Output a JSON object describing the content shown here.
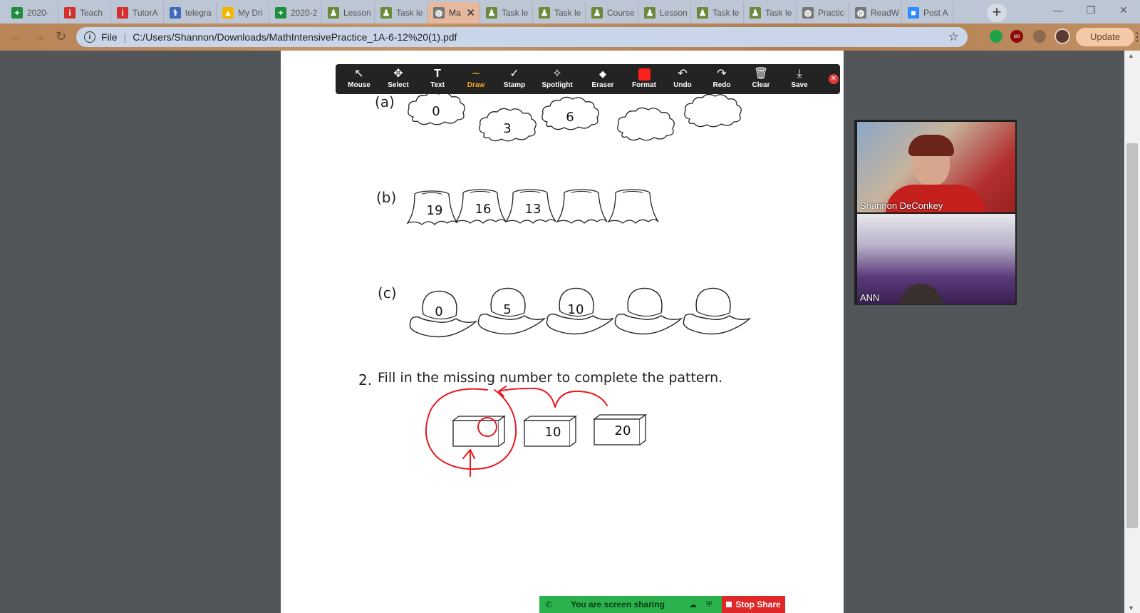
{
  "browser": {
    "tabs": [
      {
        "title": "2020-",
        "icon": "sheets-icon",
        "color": "#1e8e3e"
      },
      {
        "title": "Teach",
        "icon": "instructure-icon",
        "color": "#d32f2f"
      },
      {
        "title": "TutorA",
        "icon": "instructure-icon",
        "color": "#d32f2f"
      },
      {
        "title": "telegra",
        "icon": "telegraph-icon",
        "color": "#3f6ab8"
      },
      {
        "title": "My Dri",
        "icon": "drive-icon",
        "color": "#f4b400"
      },
      {
        "title": "2020-2",
        "icon": "sheets-icon",
        "color": "#1e8e3e"
      },
      {
        "title": "Lesson",
        "icon": "doc-icon",
        "color": "#6a8a3a"
      },
      {
        "title": "Task le",
        "icon": "doc-icon",
        "color": "#6a8a3a"
      },
      {
        "title": "Ma",
        "icon": "globe-icon",
        "color": "#777777",
        "active": true
      },
      {
        "title": "Task le",
        "icon": "doc-icon",
        "color": "#6a8a3a"
      },
      {
        "title": "Task le",
        "icon": "doc-icon",
        "color": "#6a8a3a"
      },
      {
        "title": "Course",
        "icon": "doc-icon",
        "color": "#6a8a3a"
      },
      {
        "title": "Lesson",
        "icon": "doc-icon",
        "color": "#6a8a3a"
      },
      {
        "title": "Task le",
        "icon": "doc-icon",
        "color": "#6a8a3a"
      },
      {
        "title": "Task le",
        "icon": "doc-icon",
        "color": "#6a8a3a"
      },
      {
        "title": "Practic",
        "icon": "globe-icon",
        "color": "#777777"
      },
      {
        "title": "ReadW",
        "icon": "globe-icon",
        "color": "#777777"
      },
      {
        "title": "Post A",
        "icon": "zoom-icon",
        "color": "#2d8cff"
      }
    ],
    "file_label": "File",
    "url": "C:/Users/Shannon/Downloads/MathIntensivePractice_1A-6-12%20(1).pdf",
    "update_label": "Update"
  },
  "zoom_toolbar": {
    "tools": [
      {
        "label": "Mouse",
        "icon": "cursor-icon"
      },
      {
        "label": "Select",
        "icon": "move-icon"
      },
      {
        "label": "Text",
        "icon": "text-icon"
      },
      {
        "label": "Draw",
        "icon": "draw-icon",
        "active": true
      },
      {
        "label": "Stamp",
        "icon": "check-icon"
      },
      {
        "label": "Spotlight",
        "icon": "wand-icon"
      },
      {
        "label": "Eraser",
        "icon": "eraser-icon"
      },
      {
        "label": "Format",
        "icon": "format-swatch-icon"
      },
      {
        "label": "Undo",
        "icon": "undo-icon"
      },
      {
        "label": "Redo",
        "icon": "redo-icon"
      },
      {
        "label": "Clear",
        "icon": "trash-icon"
      },
      {
        "label": "Save",
        "icon": "save-icon"
      }
    ],
    "format_color": "#ff1f1f"
  },
  "worksheet": {
    "a": {
      "label": "(a)",
      "clouds": [
        "0",
        "3",
        "6",
        "",
        ""
      ]
    },
    "b": {
      "label": "(b)",
      "stumps": [
        "19",
        "16",
        "13",
        "",
        ""
      ]
    },
    "c": {
      "label": "(c)",
      "hats": [
        "0",
        "5",
        "10",
        "",
        ""
      ]
    },
    "q2": {
      "number": "2.",
      "text": "Fill in the missing number to complete the pattern.",
      "boxes": [
        "",
        "10",
        "20"
      ]
    },
    "annotation_color": "#e8191f"
  },
  "video": {
    "participants": [
      {
        "name": "Shannon DeConkey"
      },
      {
        "name": "ANN"
      }
    ]
  },
  "share_bar": {
    "status": "You are screen sharing",
    "stop_label": "Stop Share",
    "status_color": "#2bb24c",
    "stop_color": "#e02828"
  }
}
